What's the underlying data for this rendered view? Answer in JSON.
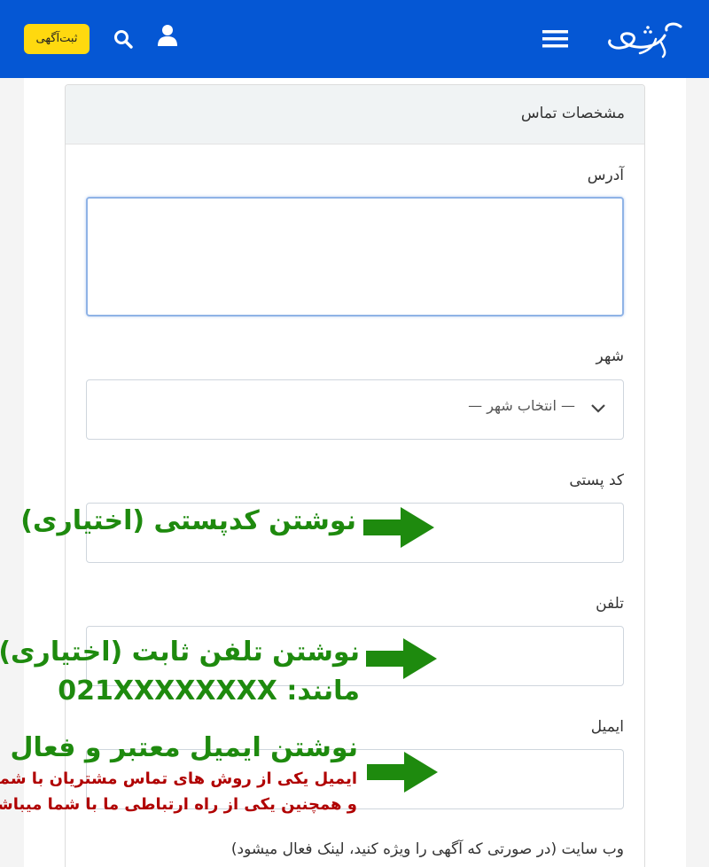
{
  "header": {
    "post_ad_label": "ثبت‌آگهی",
    "logo_text": "کاوش بازار",
    "background_color": "#0557d4",
    "accent_color": "#ffd90f"
  },
  "form": {
    "section_title": "مشخصات تماس",
    "address_label": "آدرس",
    "address_value": "",
    "city_label": "شهر",
    "city_selected": "— انتخاب شهر —",
    "postal_label": "کد پستی",
    "postal_value": "",
    "phone_label": "تلفن",
    "phone_value": "",
    "email_label": "ایمیل",
    "email_value": "",
    "website_label": "وب سایت (در صورتی که آگهی را ویژه کنید، لینک فعال میشود)"
  },
  "annotations": {
    "postal": "نوشتن کدپستی (اختیاری)",
    "phone_line1": "نوشتن تلفن ثابت (اختیاری)",
    "phone_line2": "مانند: 021XXXXXXXX",
    "email_title": "نوشتن ایمیل معتبر و فعال",
    "email_note_line1": "ایمیل یکی از روش های تماس مشتریان با شما",
    "email_note_line2": "و همچنین یکی از راه ارتباطی ما با شما میباشد",
    "green_color": "#1e8a0e",
    "red_color": "#b00000"
  }
}
